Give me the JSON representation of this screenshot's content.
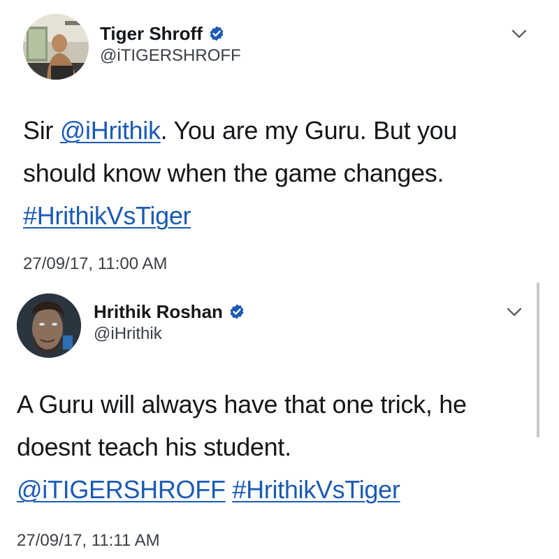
{
  "colors": {
    "link": "#1b5ab5",
    "verified_badge": "#1b5ab5",
    "text": "#14171a",
    "muted_text": "#3a3f45"
  },
  "tweets": [
    {
      "display_name": "Tiger Shroff",
      "handle": "@iTIGERSHROFF",
      "verified_icon": "verified-badge-icon",
      "menu_icon": "chevron-down-icon",
      "text_lines": [
        {
          "prefix": "Sir ",
          "mention": "@iHrithik",
          "suffix": ". You are my Guru. But you"
        },
        {
          "text": "should know when the game changes."
        },
        {
          "hashtag": "#HrithikVsTiger"
        }
      ],
      "timestamp": "27/09/17, 11:00 AM"
    },
    {
      "display_name": "Hrithik Roshan",
      "handle": "@iHrithik",
      "verified_icon": "verified-badge-icon",
      "menu_icon": "chevron-down-icon",
      "text_lines": [
        {
          "text": "A Guru will always have that one trick, he"
        },
        {
          "text": "doesnt teach his student."
        },
        {
          "mention": "@iTIGERSHROFF",
          "hashtag": "#HrithikVsTiger"
        }
      ],
      "timestamp": "27/09/17, 11:11 AM"
    }
  ]
}
